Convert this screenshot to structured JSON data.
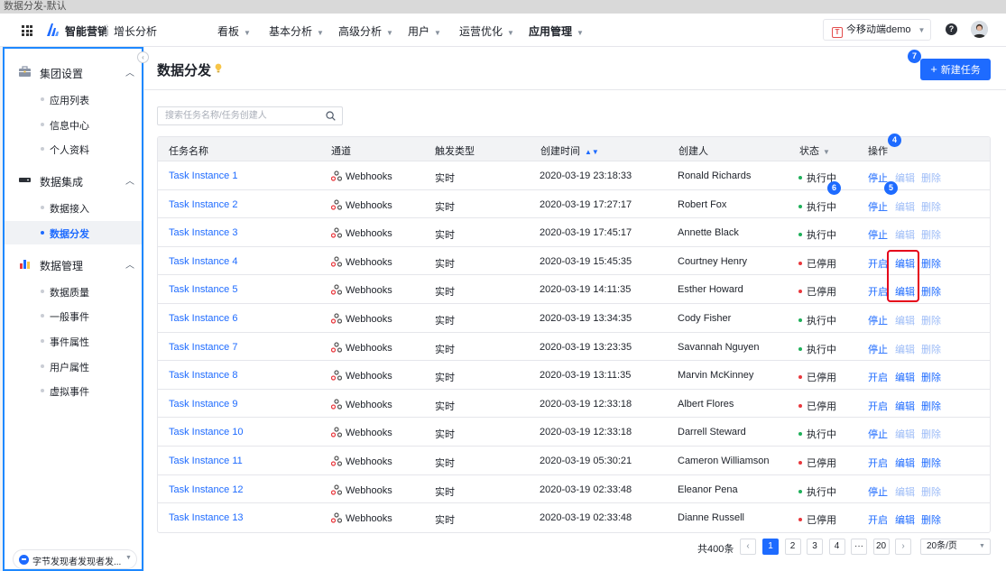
{
  "window": {
    "title": "数据分发-默认"
  },
  "topnav": {
    "brand": "智能营销",
    "sub_brand": "增长分析",
    "menus": [
      {
        "label": "看板",
        "active": false
      },
      {
        "label": "基本分析",
        "active": false
      },
      {
        "label": "高级分析",
        "active": false
      },
      {
        "label": "用户",
        "active": false
      },
      {
        "label": "运营优化",
        "active": false
      },
      {
        "label": "应用管理",
        "active": true
      }
    ],
    "app_badge": "T",
    "app_name": "今移动端demo",
    "help_label": "?"
  },
  "sidebar": {
    "groups": [
      {
        "label": "集团设置",
        "icon": "briefcase-icon",
        "items": [
          "应用列表",
          "信息中心",
          "个人资料"
        ]
      },
      {
        "label": "数据集成",
        "icon": "server-icon",
        "items": [
          "数据接入",
          "数据分发"
        ]
      },
      {
        "label": "数据管理",
        "icon": "bar-chart-icon",
        "items": [
          "数据质量",
          "一般事件",
          "事件属性",
          "用户属性",
          "虚拟事件"
        ]
      }
    ],
    "active_item": "数据分发",
    "org": "字节发现者发现者发..."
  },
  "page": {
    "title": "数据分发",
    "new_button": "新建任务",
    "search_placeholder": "搜索任务名称/任务创建人"
  },
  "badges": {
    "new": "7",
    "ops_header": "4",
    "edit": "5",
    "status": "6"
  },
  "table": {
    "columns": [
      "任务名称",
      "通道",
      "触发类型",
      "创建时间",
      "创建人",
      "状态",
      "操作"
    ],
    "actions": {
      "stop": "停止",
      "start": "开启",
      "edit": "编辑",
      "delete": "删除"
    },
    "status_labels": {
      "running": "执行中",
      "stopped": "已停用"
    },
    "colors": {
      "running": "#1fb05a",
      "stopped": "#e8383d",
      "link": "#1e6bff"
    },
    "rows": [
      {
        "name": "Task Instance 1",
        "channel": "Webhooks",
        "trigger": "实时",
        "time": "2020-03-19  23:18:33",
        "creator": "Ronald Richards",
        "status": "running"
      },
      {
        "name": "Task Instance 2",
        "channel": "Webhooks",
        "trigger": "实时",
        "time": "2020-03-19  17:27:17",
        "creator": "Robert Fox",
        "status": "running"
      },
      {
        "name": "Task Instance 3",
        "channel": "Webhooks",
        "trigger": "实时",
        "time": "2020-03-19  17:45:17",
        "creator": "Annette Black",
        "status": "running"
      },
      {
        "name": "Task Instance 4",
        "channel": "Webhooks",
        "trigger": "实时",
        "time": "2020-03-19  15:45:35",
        "creator": "Courtney Henry",
        "status": "stopped"
      },
      {
        "name": "Task Instance 5",
        "channel": "Webhooks",
        "trigger": "实时",
        "time": "2020-03-19  14:11:35",
        "creator": "Esther Howard",
        "status": "stopped"
      },
      {
        "name": "Task Instance 6",
        "channel": "Webhooks",
        "trigger": "实时",
        "time": "2020-03-19  13:34:35",
        "creator": "Cody Fisher",
        "status": "running"
      },
      {
        "name": "Task Instance 7",
        "channel": "Webhooks",
        "trigger": "实时",
        "time": "2020-03-19  13:23:35",
        "creator": "Savannah Nguyen",
        "status": "running"
      },
      {
        "name": "Task Instance 8",
        "channel": "Webhooks",
        "trigger": "实时",
        "time": "2020-03-19  13:11:35",
        "creator": "Marvin McKinney",
        "status": "stopped"
      },
      {
        "name": "Task Instance 9",
        "channel": "Webhooks",
        "trigger": "实时",
        "time": "2020-03-19  12:33:18",
        "creator": "Albert Flores",
        "status": "stopped"
      },
      {
        "name": "Task Instance 10",
        "channel": "Webhooks",
        "trigger": "实时",
        "time": "2020-03-19  12:33:18",
        "creator": "Darrell Steward",
        "status": "running"
      },
      {
        "name": "Task Instance 11",
        "channel": "Webhooks",
        "trigger": "实时",
        "time": "2020-03-19  05:30:21",
        "creator": "Cameron Williamson",
        "status": "stopped"
      },
      {
        "name": "Task Instance 12",
        "channel": "Webhooks",
        "trigger": "实时",
        "time": "2020-03-19  02:33:48",
        "creator": "Eleanor Pena",
        "status": "running"
      },
      {
        "name": "Task Instance 13",
        "channel": "Webhooks",
        "trigger": "实时",
        "time": "2020-03-19  02:33:48",
        "creator": "Dianne Russell",
        "status": "stopped"
      }
    ]
  },
  "pagination": {
    "total": "共400条",
    "prev": "‹",
    "next": "›",
    "pages": [
      "1",
      "2",
      "3",
      "4",
      "···",
      "20"
    ],
    "current": "1",
    "page_size": "20条/页"
  }
}
